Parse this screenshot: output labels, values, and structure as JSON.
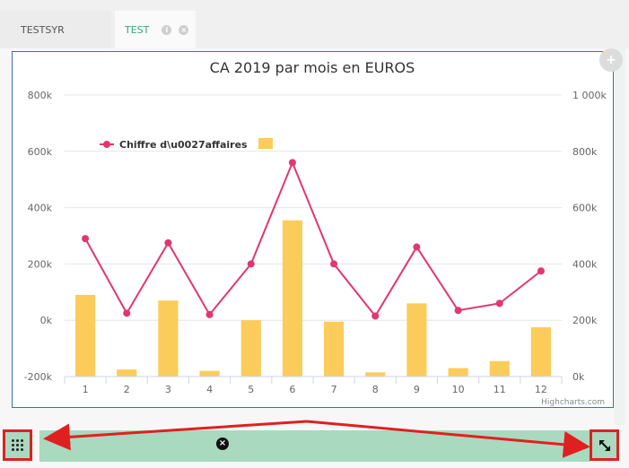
{
  "tabs": [
    {
      "label": "TESTSYR",
      "active": false
    },
    {
      "label": "TEST",
      "active": true
    }
  ],
  "tab_icons": {
    "info": "i",
    "close": "×"
  },
  "colors": {
    "line": "#e0376e",
    "bar": "#fccc5a",
    "accent_tab": "#3aa37a",
    "footer": "#a9d9bf",
    "annotation": "#e02020"
  },
  "credits": "Highcharts.com",
  "footer": {
    "close_symbol": "×"
  },
  "chart_data": {
    "type": "bar",
    "title": "CA 2019 par mois en EUROS",
    "categories": [
      "1",
      "2",
      "3",
      "4",
      "5",
      "6",
      "7",
      "8",
      "9",
      "10",
      "11",
      "12"
    ],
    "legend": {
      "entries": [
        "Chiffre d\\u0027affaires",
        ""
      ],
      "placement": "top-left"
    },
    "series": [
      {
        "name": "Chiffre d\\u0027affaires",
        "type": "line",
        "axis": "left",
        "values": [
          290000,
          25000,
          275000,
          20000,
          200000,
          560000,
          200000,
          15000,
          260000,
          35000,
          60000,
          175000
        ]
      },
      {
        "type": "bar",
        "axis": "right",
        "values": [
          290000,
          25000,
          270000,
          20000,
          200000,
          555000,
          195000,
          15000,
          260000,
          30000,
          55000,
          175000
        ]
      }
    ],
    "left_axis": {
      "ylim": [
        -200000,
        800000
      ],
      "ticks": [
        "-200k",
        "0k",
        "200k",
        "400k",
        "600k",
        "800k"
      ]
    },
    "right_axis": {
      "ylim": [
        0,
        1000000
      ],
      "ticks": [
        "0k",
        "200k",
        "400k",
        "600k",
        "800k",
        "1 000k"
      ]
    },
    "grid": true
  }
}
